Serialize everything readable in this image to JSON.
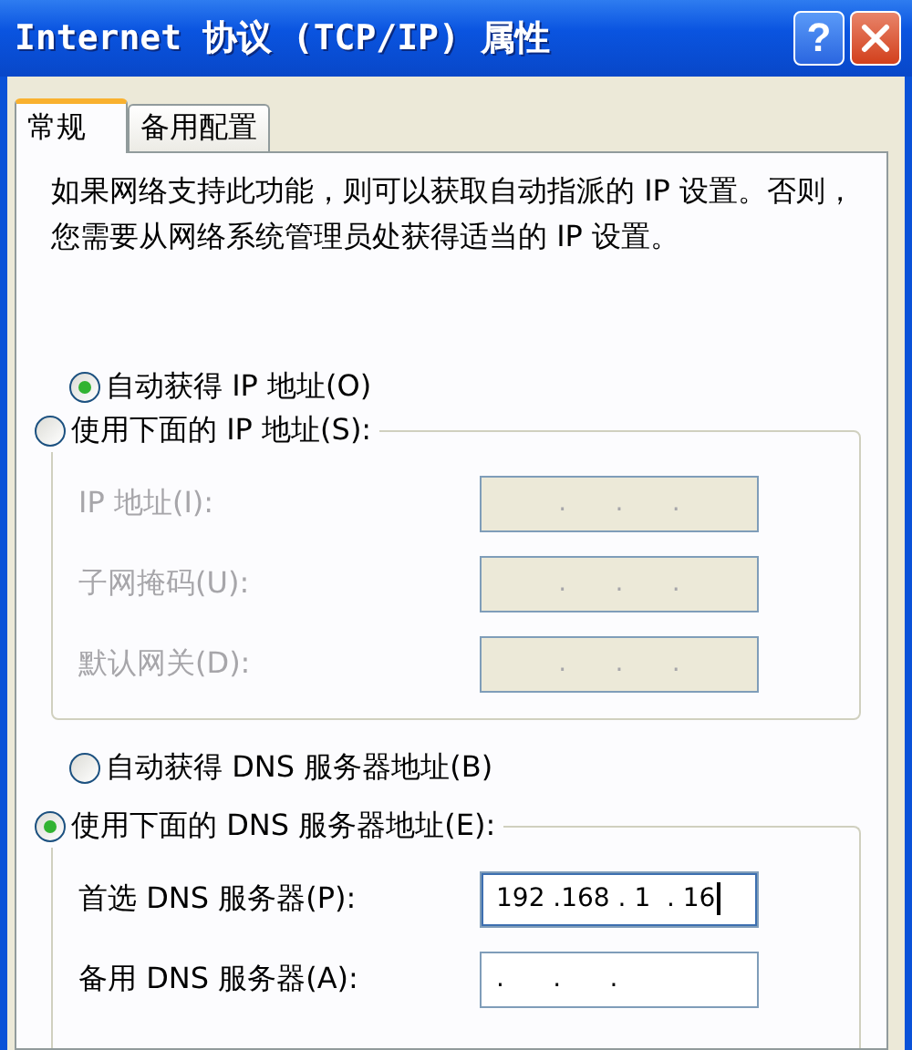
{
  "window": {
    "title": "Internet 协议 (TCP/IP) 属性",
    "help_button": "?"
  },
  "tabs": [
    {
      "label": "常规",
      "selected": true
    },
    {
      "label": "备用配置",
      "selected": false
    }
  ],
  "description": "如果网络支持此功能，则可以获取自动指派的 IP 设置。否则，您需要从网络系统管理员处获得适当的 IP 设置。",
  "ip_options": {
    "auto": {
      "label": "自动获得 IP 地址(O)",
      "selected": true
    },
    "manual": {
      "label": "使用下面的 IP 地址(S):",
      "selected": false,
      "fields": [
        {
          "label": "IP 地址(I):",
          "value": ".      .      ."
        },
        {
          "label": "子网掩码(U):",
          "value": ".      .      ."
        },
        {
          "label": "默认网关(D):",
          "value": ".      .      ."
        }
      ]
    }
  },
  "dns_options": {
    "auto": {
      "label": "自动获得 DNS 服务器地址(B)",
      "selected": false
    },
    "manual": {
      "label": "使用下面的 DNS 服务器地址(E):",
      "selected": true,
      "fields": [
        {
          "label": "首选 DNS 服务器(P):",
          "value": "192 .168 . 1  . 16",
          "focused": true
        },
        {
          "label": "备用 DNS 服务器(A):",
          "value": ".      .      .",
          "focused": false
        }
      ]
    }
  }
}
